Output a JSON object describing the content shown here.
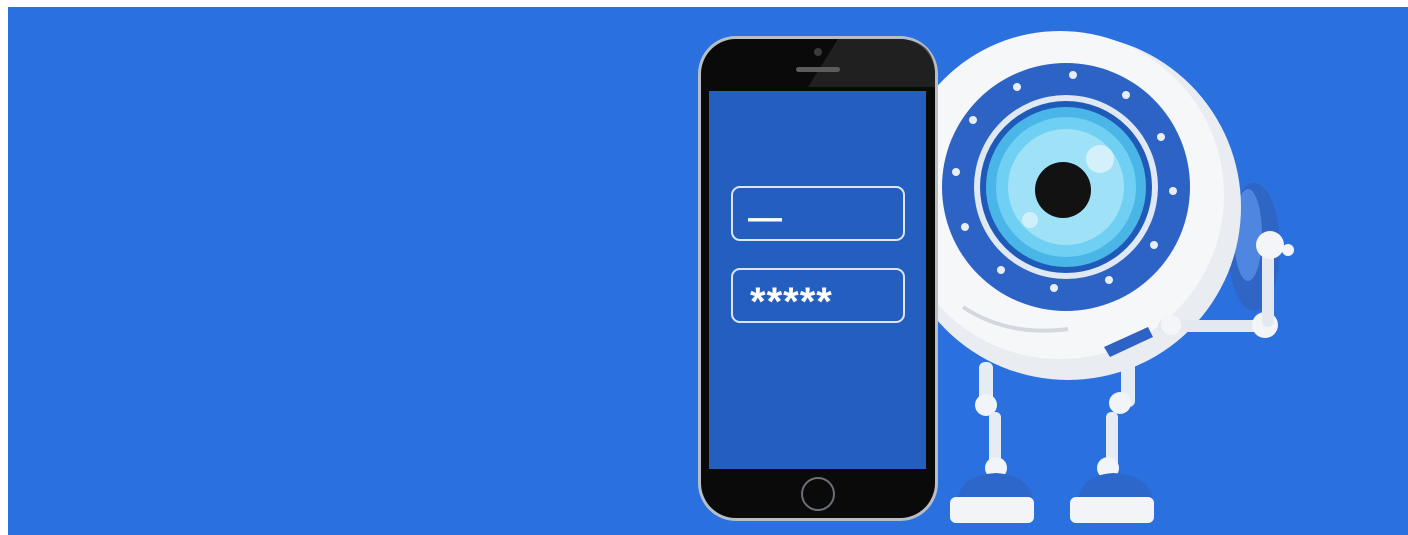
{
  "top_link": {
    "label": "",
    "underline_color": "#0000ee"
  },
  "banner": {
    "background": "#2a70df"
  },
  "phone": {
    "username_mask": "—",
    "password_mask": "*****",
    "screen_color": "#245fbf"
  },
  "mascot": {
    "name_icon": "eye-robot-icon"
  }
}
